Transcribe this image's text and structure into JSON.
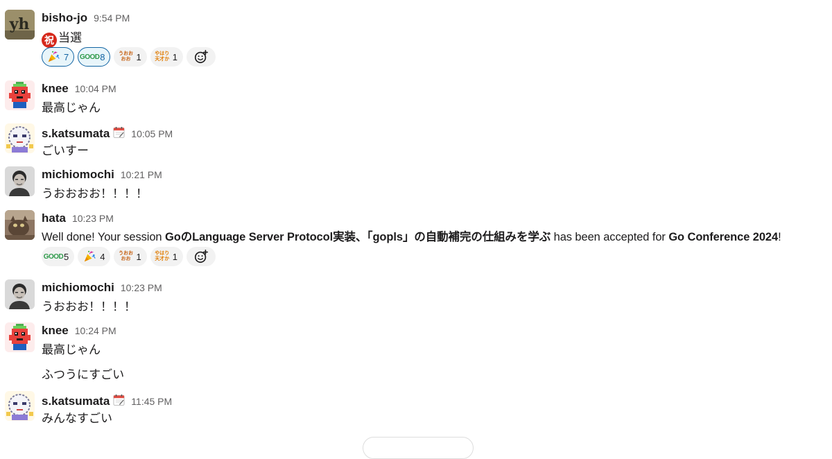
{
  "messages": [
    {
      "author": "bisho-jo",
      "time": "9:54 PM",
      "body_badge": "祝",
      "body": "当選",
      "reactions": [
        {
          "emoji": "tada-emoji",
          "count": "7"
        },
        {
          "emoji": "good-emoji",
          "count": "8"
        },
        {
          "emoji": "uooo-emoji",
          "count": "1"
        },
        {
          "emoji": "yappari-tensai-emoji",
          "count": "1"
        }
      ]
    },
    {
      "author": "knee",
      "time": "10:04 PM",
      "body": "最高じゃん"
    },
    {
      "author": "s.katsumata",
      "time": "10:05 PM",
      "body": "ごいすー",
      "status_icon": "calendar-icon"
    },
    {
      "author": "michiomochi",
      "time": "10:21 PM",
      "body": "うおおおお！！！！"
    },
    {
      "author": "hata",
      "time": "10:23 PM",
      "body_parts": {
        "p1": "Well done! Your session ",
        "p2": "GoのLanguage Server Protocol実装、「gopls」の自動補完の仕組みを学ぶ",
        "p3": " has been accepted for ",
        "p4": "Go Conference 2024",
        "p5": "!"
      },
      "reactions": [
        {
          "emoji": "good-emoji",
          "count": "5"
        },
        {
          "emoji": "tada-emoji",
          "count": "4"
        },
        {
          "emoji": "uooo-emoji",
          "count": "1"
        },
        {
          "emoji": "yappari-tensai-emoji",
          "count": "1"
        }
      ]
    },
    {
      "author": "michiomochi",
      "time": "10:23 PM",
      "body": "うおおお！！！！"
    },
    {
      "author": "knee",
      "time": "10:24 PM",
      "body": "最高じゃん",
      "body2": "ふつうにすごい"
    },
    {
      "author": "s.katsumata",
      "time": "11:45 PM",
      "body": "みんなすごい",
      "status_icon": "calendar-icon"
    }
  ],
  "emoji_text": {
    "good": "GOOD",
    "uooo_top": "うおお",
    "uooo_bottom": "おお",
    "yappari_top": "やはり",
    "yappari_bottom": "天才か",
    "avatar_yh": "yh"
  }
}
